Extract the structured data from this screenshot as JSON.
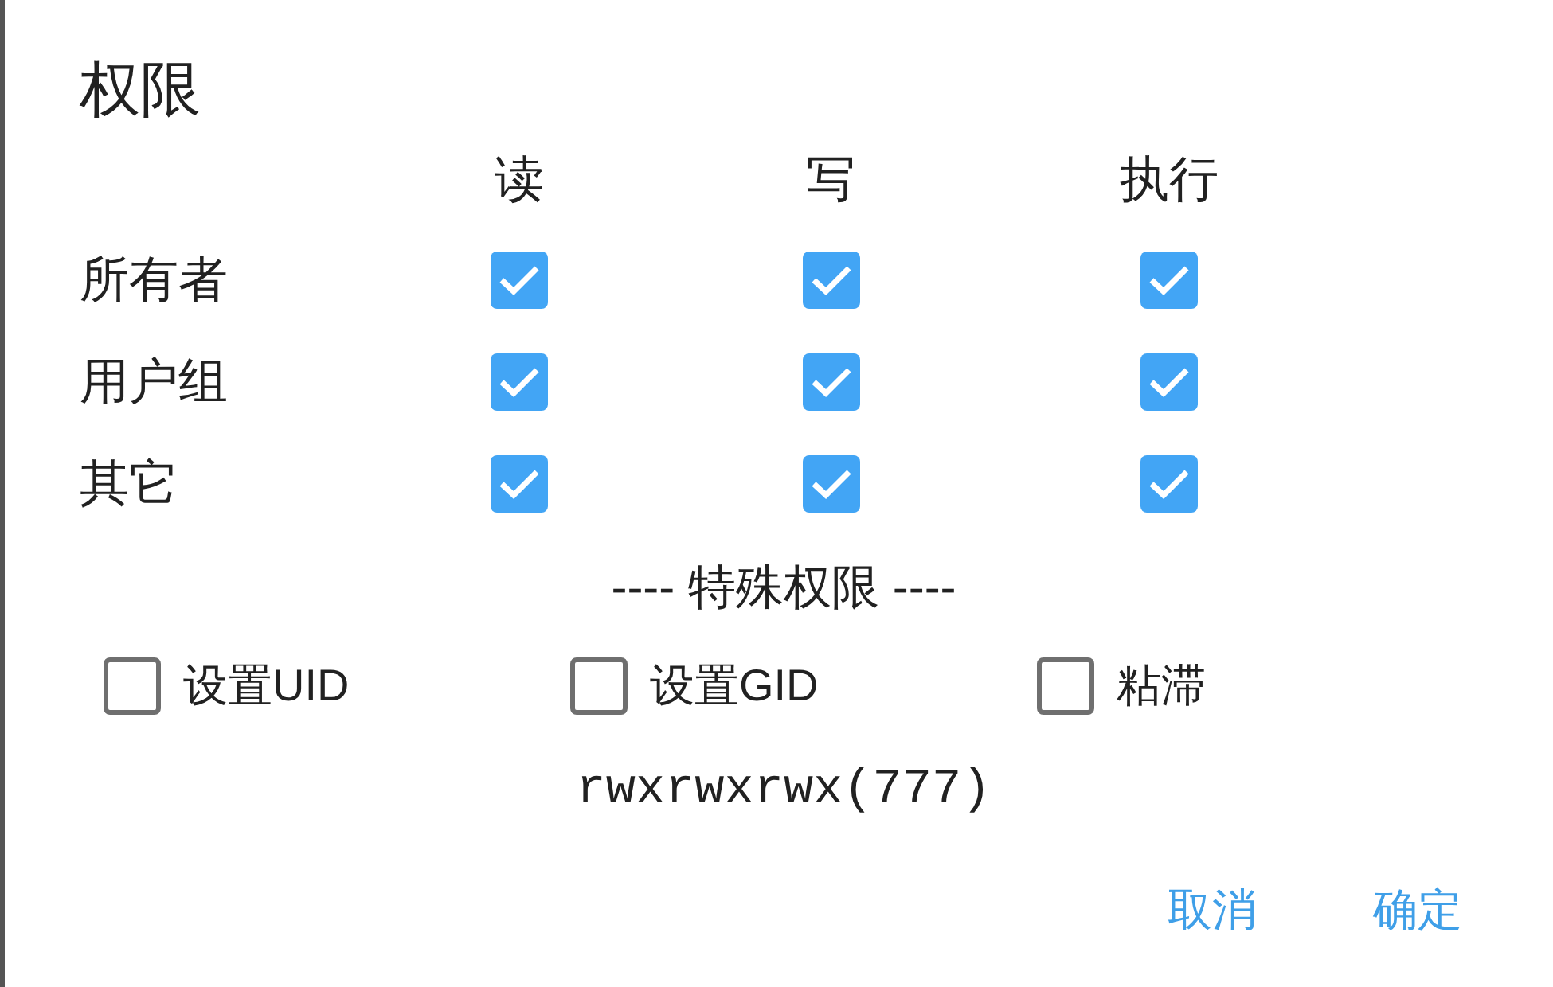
{
  "dialog": {
    "title": "权限",
    "columns": [
      "读",
      "写",
      "执行"
    ],
    "rows": [
      {
        "label": "所有者",
        "permissions": [
          {
            "checked": true
          },
          {
            "checked": true
          },
          {
            "checked": true
          }
        ]
      },
      {
        "label": "用户组",
        "permissions": [
          {
            "checked": true
          },
          {
            "checked": true
          },
          {
            "checked": true
          }
        ]
      },
      {
        "label": "其它",
        "permissions": [
          {
            "checked": true
          },
          {
            "checked": true
          },
          {
            "checked": true
          }
        ]
      }
    ],
    "special_heading": "---- 特殊权限 ----",
    "special_options": [
      {
        "label": "设置UID",
        "checked": false
      },
      {
        "label": "设置GID",
        "checked": false
      },
      {
        "label": "粘滞",
        "checked": false
      }
    ],
    "mode_text": "rwxrwxrwx(777)",
    "buttons": [
      {
        "label": "取消"
      },
      {
        "label": "确定"
      }
    ]
  }
}
